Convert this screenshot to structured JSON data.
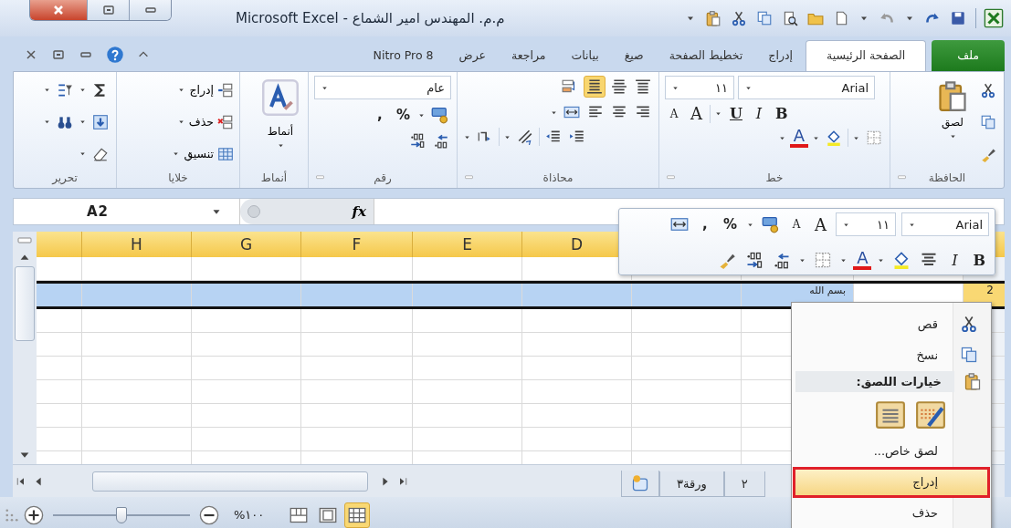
{
  "window": {
    "title": "م.م. المهندس امير الشماع - Microsoft Excel"
  },
  "tabs": [
    {
      "label": "ملف",
      "kind": "file",
      "selected": false
    },
    {
      "label": "الصفحة الرئيسية",
      "kind": "tab",
      "selected": true
    },
    {
      "label": "إدراج",
      "kind": "tab",
      "selected": false
    },
    {
      "label": "تخطيط الصفحة",
      "kind": "tab",
      "selected": false
    },
    {
      "label": "صيغ",
      "kind": "tab",
      "selected": false
    },
    {
      "label": "بيانات",
      "kind": "tab",
      "selected": false
    },
    {
      "label": "مراجعة",
      "kind": "tab",
      "selected": false
    },
    {
      "label": "عرض",
      "kind": "tab",
      "selected": false
    },
    {
      "label": "Nitro Pro 8",
      "kind": "tab",
      "selected": false
    }
  ],
  "ribbon": {
    "groups": [
      {
        "kind": "clipboard",
        "label": "الحافظة",
        "paste": "لصق"
      },
      {
        "kind": "font",
        "label": "خط",
        "font": "Arial",
        "size": "١١",
        "shrink": "A",
        "grow": "A",
        "underline": "U",
        "italic": "I",
        "bold": "B",
        "font_color": "A"
      },
      {
        "kind": "alignment",
        "label": "محاذاة"
      },
      {
        "kind": "number",
        "label": "رقم",
        "format": "عام",
        "percent": "%",
        "comma": ","
      },
      {
        "kind": "styles",
        "label": "أنماط",
        "button": "أنماط"
      },
      {
        "kind": "cells",
        "label": "خلايا",
        "buttons": [
          "إدراج",
          "حذف",
          "تنسيق"
        ]
      },
      {
        "kind": "editing",
        "label": "تحرير"
      }
    ]
  },
  "formula_bar": {
    "name_box": "A2",
    "function_label": "fx"
  },
  "sheet": {
    "columns": [
      "D",
      "E",
      "F",
      "G",
      "H"
    ],
    "rows": [
      {
        "selected": false
      },
      {
        "selected": true,
        "header": "2",
        "cell": "بسم الله"
      },
      {
        "selected": false
      },
      {
        "selected": false
      },
      {
        "selected": false
      },
      {
        "selected": false
      },
      {
        "selected": false
      },
      {
        "selected": false
      },
      {
        "selected": false
      }
    ]
  },
  "mini_toolbar": {
    "font": "Arial",
    "size": "١١",
    "comma": ",",
    "percent": "%",
    "shrink": "A",
    "grow": "A",
    "font_color": "A",
    "italic": "I",
    "bold": "B"
  },
  "context_menu": {
    "items": [
      {
        "kind": "item",
        "label": "قص",
        "selected": false
      },
      {
        "kind": "item",
        "label": "نسخ",
        "selected": false
      },
      {
        "kind": "header",
        "label": "خيارات اللصق:"
      },
      {
        "kind": "paste-options"
      },
      {
        "kind": "item",
        "label": "لصق خاص...",
        "selected": false
      },
      {
        "kind": "item",
        "label": "إدراج",
        "selected": true
      },
      {
        "kind": "item",
        "label": "حذف",
        "selected": false
      }
    ]
  },
  "sheet_tabs": [
    {
      "label": "٢"
    },
    {
      "label": "ورقة٣"
    }
  ],
  "status_bar": {
    "zoom": "%١٠٠",
    "zoom_slider": {
      "level": 0.5
    },
    "views": [
      {
        "kind": "page-break",
        "selected": false
      },
      {
        "kind": "page-layout",
        "selected": false
      },
      {
        "kind": "normal",
        "selected": true
      }
    ]
  }
}
